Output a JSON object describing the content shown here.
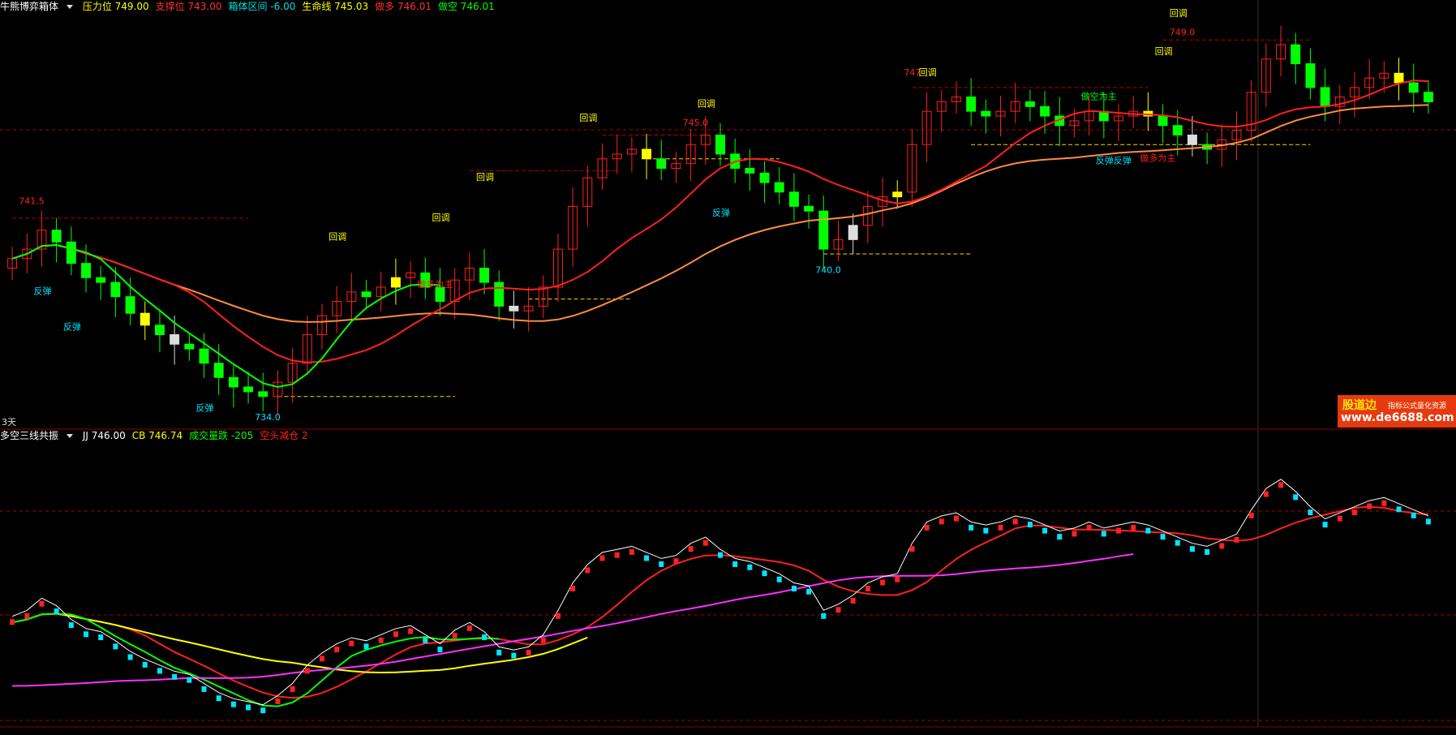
{
  "main_header": {
    "indicator_name": "牛熊博弈箱体",
    "items": [
      {
        "label": "压力位",
        "value": "749.00",
        "color": "#ffff00"
      },
      {
        "label": "支撑位",
        "value": "743.00",
        "color": "#ff3030"
      },
      {
        "label": "箱体区间",
        "value": "-6.00",
        "color": "#00e0e0"
      },
      {
        "label": "生命线",
        "value": "745.03",
        "color": "#ffff00"
      },
      {
        "label": "做多",
        "value": "746.01",
        "color": "#ff3030"
      },
      {
        "label": "做空",
        "value": "746.01",
        "color": "#00ff00"
      }
    ]
  },
  "sub_header": {
    "indicator_name": "多空三线共振",
    "items": [
      {
        "label": "JJ",
        "value": "746.00",
        "color": "#ffffff"
      },
      {
        "label": "CB",
        "value": "746.74",
        "color": "#ffff00"
      },
      {
        "label": "成交量跌",
        "value": "-205",
        "color": "#00ff00"
      },
      {
        "label": "空头减仓",
        "value": "2",
        "color": "#ff2020"
      }
    ]
  },
  "period_label": "3天",
  "watermark": {
    "brand": "股道边",
    "tagline": "指标公式量化资源",
    "url": "www.de6688.com"
  },
  "annotations": {
    "prices": [
      "741.5",
      "734.0",
      "745.0",
      "740.0",
      "747",
      "749.0"
    ],
    "huitiao": "回调",
    "fantan": "反弹",
    "fanfantan": "反弹反弹",
    "zuoduo": "做多为主",
    "zuokong": "做空为主"
  },
  "colors": {
    "up": "#ff2020",
    "down": "#00ff00",
    "cyan": "#00e5ff",
    "yellow": "#ffff00",
    "orange": "#ff8c40",
    "magenta": "#ff30ff",
    "guide": "#b00000"
  },
  "chart_data": {
    "type": "candlestick",
    "title": "牛熊博弈箱体 / 多空三线共振",
    "price_range": [
      733,
      750
    ],
    "close_series": [
      739.8,
      740.2,
      741.0,
      740.5,
      739.6,
      739.0,
      738.8,
      738.2,
      737.5,
      737.0,
      736.6,
      736.2,
      736.0,
      735.4,
      734.8,
      734.4,
      734.2,
      734.0,
      734.6,
      735.4,
      736.6,
      737.4,
      738.0,
      738.4,
      738.2,
      738.6,
      739.0,
      739.2,
      738.6,
      738.0,
      738.9,
      739.4,
      738.8,
      737.8,
      737.6,
      737.8,
      738.6,
      740.2,
      742.0,
      743.2,
      744.0,
      744.2,
      744.4,
      744.0,
      743.6,
      743.8,
      744.6,
      745.0,
      744.2,
      743.6,
      743.4,
      743.0,
      742.6,
      742.0,
      741.8,
      740.2,
      740.6,
      741.2,
      742.0,
      742.4,
      742.6,
      744.6,
      746.0,
      746.4,
      746.6,
      746.0,
      745.8,
      746.0,
      746.4,
      746.2,
      745.8,
      745.4,
      745.6,
      746.0,
      745.6,
      745.8,
      746.0,
      745.8,
      745.4,
      745.0,
      744.6,
      744.4,
      744.8,
      745.2,
      746.8,
      748.2,
      748.8,
      748.0,
      747.0,
      746.2,
      746.6,
      747.0,
      747.4,
      747.6,
      747.2,
      746.8,
      746.4
    ],
    "support_lines": [
      734.0,
      740.0,
      744.0
    ],
    "resistance_lines": [
      741.5,
      745.0,
      747,
      749.0
    ]
  }
}
